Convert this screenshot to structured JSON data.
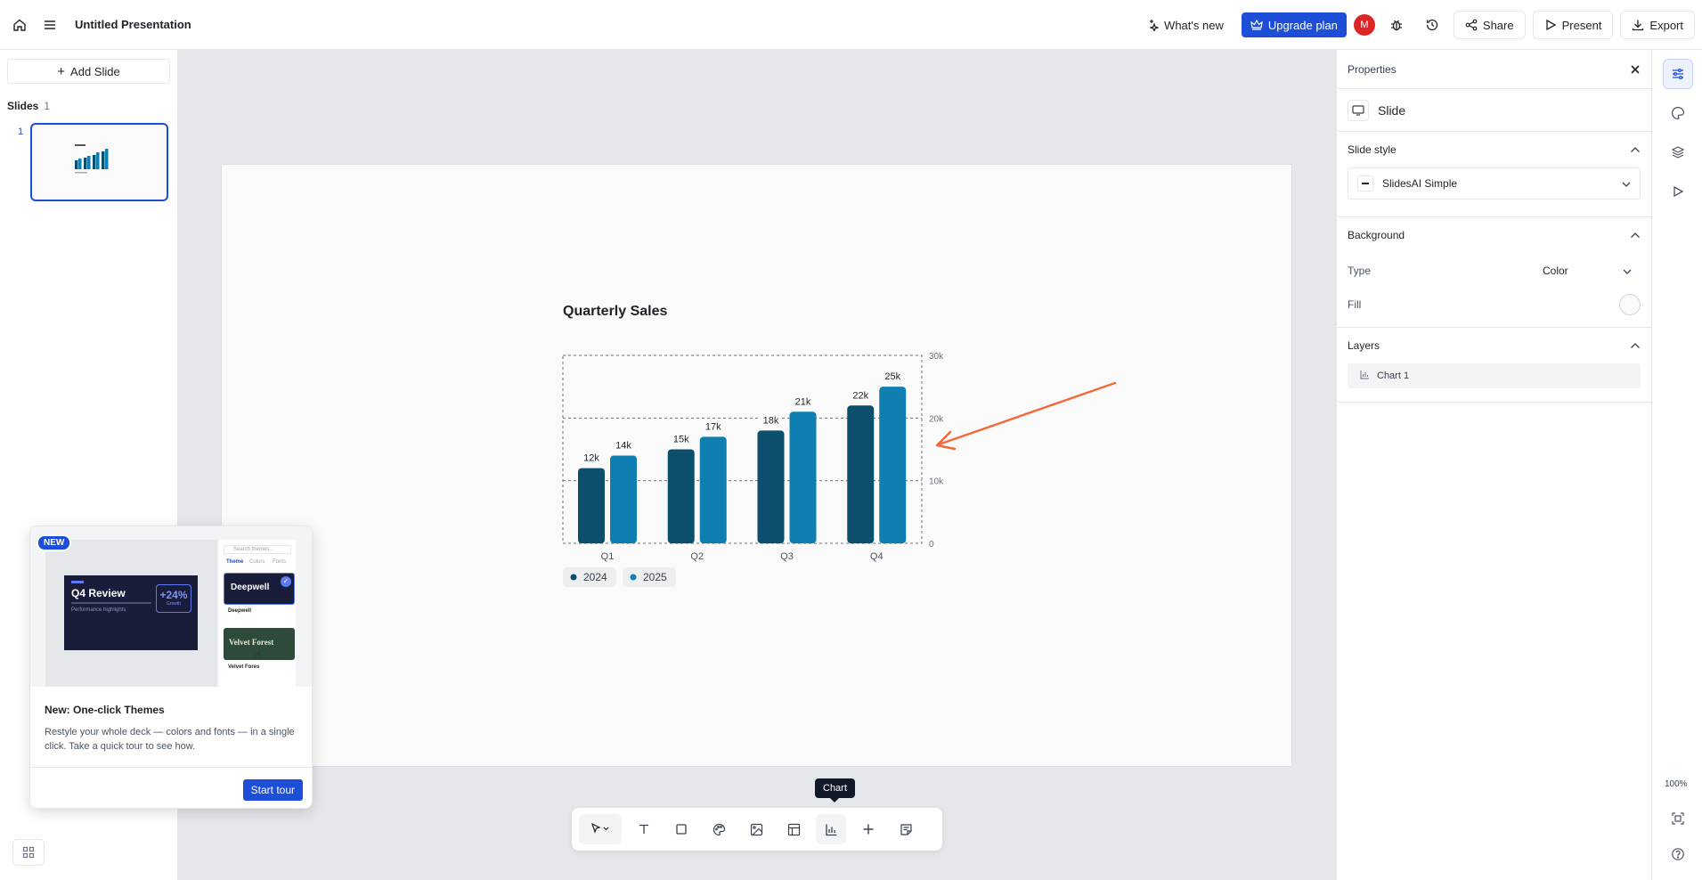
{
  "topbar": {
    "title": "Untitled Presentation",
    "whats_new": "What's new",
    "upgrade": "Upgrade plan",
    "avatar_letter": "M",
    "share": "Share",
    "present": "Present",
    "export": "Export"
  },
  "left": {
    "add_slide": "Add Slide",
    "slides_label": "Slides",
    "slides_count": "1",
    "slide_number": "1"
  },
  "chart_data": {
    "type": "bar",
    "title": "Quarterly Sales",
    "categories": [
      "Q1",
      "Q2",
      "Q3",
      "Q4"
    ],
    "series": [
      {
        "name": "2024",
        "values": [
          12,
          15,
          18,
          22
        ],
        "labels": [
          "12k",
          "15k",
          "18k",
          "22k"
        ],
        "color": "#0b4f6c"
      },
      {
        "name": "2025",
        "values": [
          14,
          17,
          21,
          25
        ],
        "labels": [
          "14k",
          "17k",
          "21k",
          "25k"
        ],
        "color": "#0e7fb0"
      }
    ],
    "ylim": [
      0,
      30
    ],
    "yticks": [
      "0",
      "10k",
      "20k",
      "30k"
    ],
    "ytick_values": [
      0,
      10,
      20,
      30
    ],
    "legend": "bottom-left",
    "grid": true
  },
  "annotation_arrow_color": "#f26a3c",
  "popup": {
    "badge": "NEW",
    "preview": {
      "card_title": "Q4 Review",
      "card_subtitle": "Performance highlights",
      "stat": "+24%",
      "stat_label": "Growth",
      "search_placeholder": "Search themes...",
      "tabs": [
        "Theme",
        "Colors",
        "Fonts"
      ],
      "themes": [
        "Deepwell",
        "Velvet Forest"
      ],
      "theme_names": [
        "Deepwell",
        "Velvet Fores"
      ]
    },
    "title": "New: One-click Themes",
    "description": "Restyle your whole deck — colors and fonts — in a single click. Take a quick tour to see how.",
    "start_tour": "Start tour"
  },
  "tooltip": "Chart",
  "properties": {
    "title": "Properties",
    "element": "Slide",
    "slide_style_label": "Slide style",
    "slide_style_value": "SlidesAI Simple",
    "background_label": "Background",
    "type_label": "Type",
    "type_value": "Color",
    "fill_label": "Fill",
    "layers_label": "Layers",
    "layer_item": "Chart 1"
  },
  "zoom": "100%",
  "colors": {
    "accent": "#1d4ed8",
    "series_2024": "#0b4f6c",
    "series_2025": "#0e7fb0"
  }
}
